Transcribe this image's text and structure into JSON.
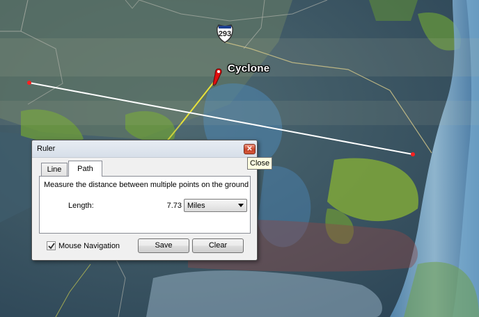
{
  "map": {
    "place_label": "Cyclone",
    "road_shield_number": "293",
    "measure_line_color": "#ffffff",
    "ground_path_color": "#e8e23a",
    "point_color": "#ff2020"
  },
  "ruler_dialog": {
    "title": "Ruler",
    "close_tooltip": "Close",
    "tabs": [
      {
        "label": "Line",
        "selected": false
      },
      {
        "label": "Path",
        "selected": true
      }
    ],
    "description": "Measure the distance between multiple points on the ground",
    "length_label": "Length:",
    "length_value": "7.73",
    "unit_selected": "Miles",
    "mouse_navigation_label": "Mouse Navigation",
    "mouse_navigation_checked": true,
    "save_label": "Save",
    "clear_label": "Clear"
  }
}
